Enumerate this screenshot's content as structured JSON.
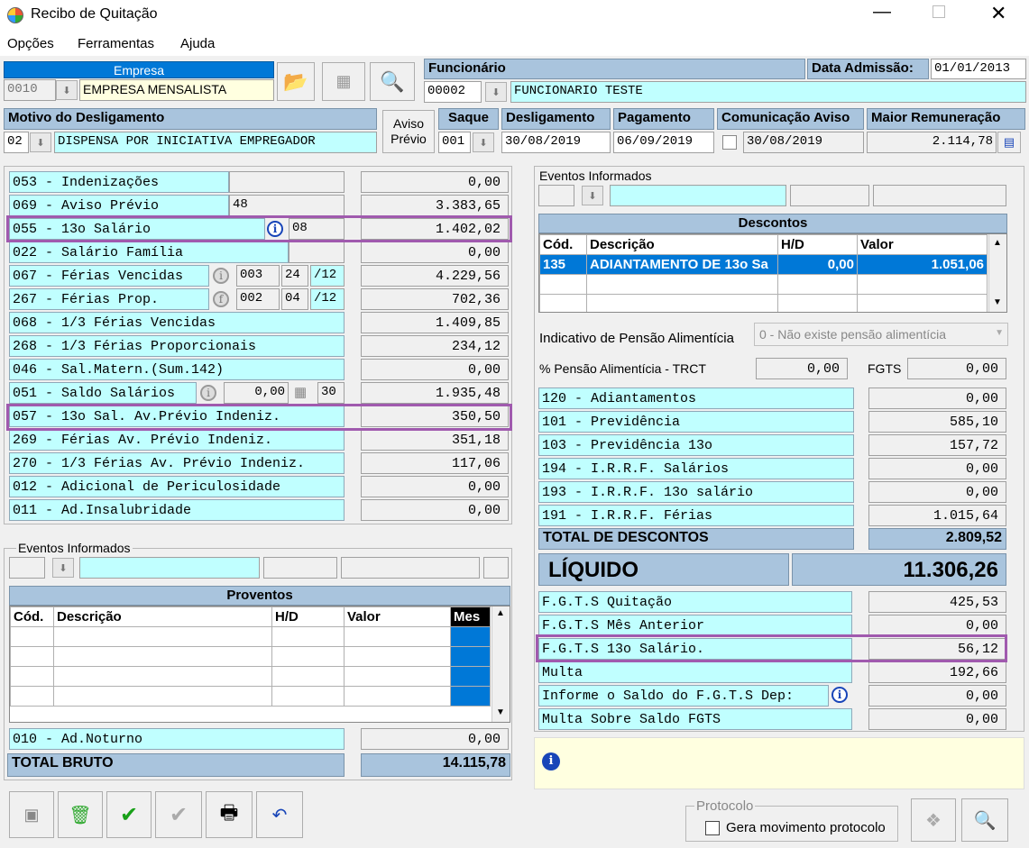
{
  "window": {
    "title": "Recibo de Quitação"
  },
  "menu": [
    "Opções",
    "Ferramentas",
    "Ajuda"
  ],
  "empresa": {
    "header": "Empresa",
    "code": "0010",
    "name": "EMPRESA MENSALISTA"
  },
  "funcionario": {
    "header": "Funcionário",
    "code": "00002",
    "name": "FUNCIONARIO TESTE",
    "admissao_label": "Data Admissão:",
    "admissao": "01/01/2013"
  },
  "motivo": {
    "header": "Motivo do Desligamento",
    "code": "02",
    "text": "DISPENSA POR INICIATIVA EMPREGADOR"
  },
  "aviso_btn": {
    "line1": "Aviso",
    "line2": "Prévio"
  },
  "saque": {
    "header": "Saque",
    "value": "001"
  },
  "desligamento": {
    "header": "Desligamento",
    "value": "30/08/2019"
  },
  "pagamento": {
    "header": "Pagamento",
    "value": "06/09/2019"
  },
  "comunicacao": {
    "header": "Comunicação Aviso",
    "value": "30/08/2019"
  },
  "maior": {
    "header": "Maior Remuneração",
    "value": "2.114,78"
  },
  "proventos_rows": [
    {
      "label": "053 - Indenizações",
      "value": "0,00"
    },
    {
      "label": "069 - Aviso Prévio",
      "extra": "48",
      "value": "3.383,65"
    },
    {
      "label": "055 - 13o Salário",
      "extra": "08",
      "value": "1.402,02"
    },
    {
      "label": "022 - Salário Família",
      "value": "0,00"
    },
    {
      "label": "067 - Férias Vencidas",
      "e1": "003",
      "e2": "24",
      "e3": "/12",
      "value": "4.229,56"
    },
    {
      "label": "267 - Férias Prop.",
      "e1": "002",
      "e2": "04",
      "e3": "/12",
      "value": "702,36"
    },
    {
      "label": "068 - 1/3 Férias Vencidas",
      "value": "1.409,85"
    },
    {
      "label": "268 - 1/3 Férias Proporcionais",
      "value": "234,12"
    },
    {
      "label": "046 - Sal.Matern.(Sum.142)",
      "value": "0,00"
    },
    {
      "label": "051 - Saldo Salários",
      "e1": "0,00",
      "e2": "30",
      "value": "1.935,48"
    },
    {
      "label": "057 - 13o Sal. Av.Prévio Indeniz.",
      "value": "350,50"
    },
    {
      "label": "269 - Férias Av. Prévio Indeniz.",
      "value": "351,18"
    },
    {
      "label": "270 - 1/3 Férias Av. Prévio Indeniz.",
      "value": "117,06"
    },
    {
      "label": "012 - Adicional de Periculosidade",
      "value": "0,00"
    },
    {
      "label": "011 - Ad.Insalubridade",
      "value": "0,00"
    }
  ],
  "eventos_left": {
    "label": "Eventos Informados"
  },
  "proventos_grid": {
    "title": "Proventos",
    "cols": [
      "Cód.",
      "Descrição",
      "H/D",
      "Valor",
      "Mes"
    ]
  },
  "ad_noturno": {
    "label": "010 - Ad.Noturno",
    "value": "0,00"
  },
  "total_bruto": {
    "label": "TOTAL BRUTO",
    "value": "14.115,78"
  },
  "eventos_right": {
    "label": "Eventos Informados"
  },
  "descontos_grid": {
    "title": "Descontos",
    "cols": [
      "Cód.",
      "Descrição",
      "H/D",
      "Valor"
    ],
    "row": {
      "cod": "135",
      "desc": "ADIANTAMENTO DE 13o Sa",
      "hd": "0,00",
      "valor": "1.051,06"
    }
  },
  "pensao": {
    "label": "Indicativo de Pensão Alimentícia",
    "value": "0 - Não existe pensão alimentícia",
    "pct_label": "% Pensão Alimentícia - TRCT",
    "pct_value": "0,00",
    "fgts_label": "FGTS",
    "fgts_value": "0,00"
  },
  "descontos_rows": [
    {
      "label": "120 - Adiantamentos",
      "value": "0,00"
    },
    {
      "label": "101 - Previdência",
      "value": "585,10"
    },
    {
      "label": "103 - Previdência 13o",
      "value": "157,72"
    },
    {
      "label": "194 - I.R.R.F. Salários",
      "value": "0,00"
    },
    {
      "label": "193 - I.R.R.F. 13o salário",
      "value": "0,00"
    },
    {
      "label": "191 - I.R.R.F. Férias",
      "value": "1.015,64"
    }
  ],
  "total_descontos": {
    "label": "TOTAL DE DESCONTOS",
    "value": "2.809,52"
  },
  "liquido": {
    "label": "LÍQUIDO",
    "value": "11.306,26"
  },
  "fgts_rows": [
    {
      "label": "F.G.T.S  Quitação",
      "value": "425,53"
    },
    {
      "label": "F.G.T.S  Mês Anterior",
      "value": "0,00"
    },
    {
      "label": "F.G.T.S  13o Salário.",
      "value": "56,12"
    },
    {
      "label": "Multa",
      "value": "192,66"
    },
    {
      "label": "Informe o Saldo do F.G.T.S Dep:",
      "value": "0,00"
    },
    {
      "label": "Multa Sobre Saldo FGTS",
      "value": "0,00"
    }
  ],
  "protocolo": {
    "label": "Protocolo",
    "checkbox": "Gera movimento protocolo"
  }
}
